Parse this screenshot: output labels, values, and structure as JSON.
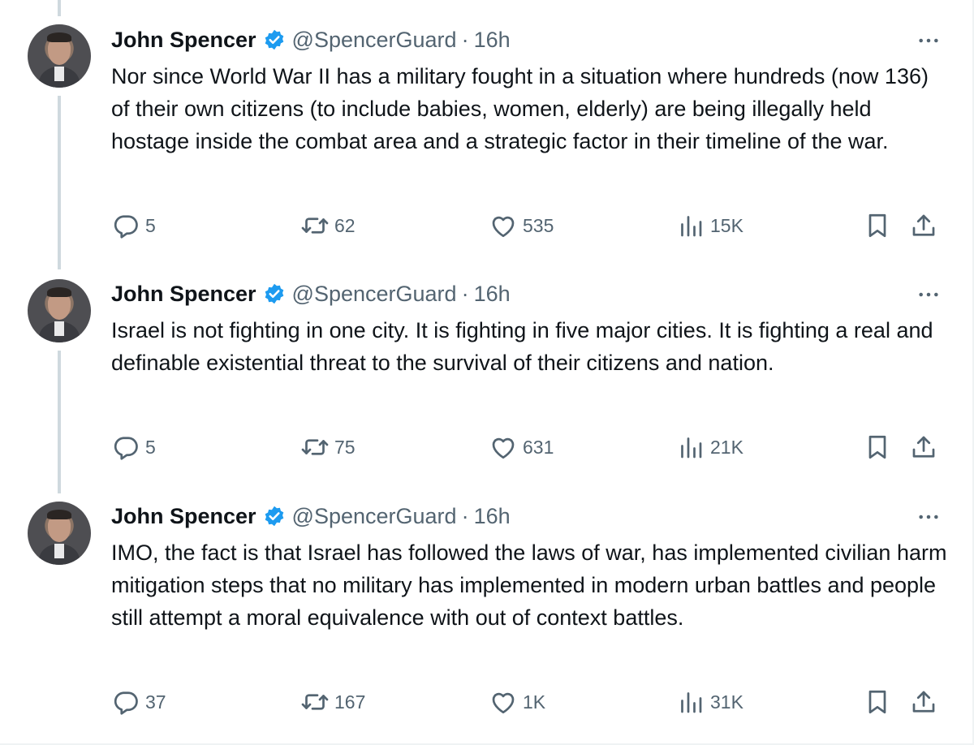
{
  "colors": {
    "verified": "#1d9bf0",
    "muted": "#536471",
    "text": "#0f1419",
    "thread_line": "#cfd9de"
  },
  "tweets": [
    {
      "name": "John Spencer",
      "handle": "@SpencerGuard",
      "separator": "·",
      "time": "16h",
      "text": "Nor since World War II has a military fought in a situation where hundreds (now 136) of their own citizens (to include babies, women, elderly) are being illegally held hostage inside the combat area and a strategic factor in their timeline of the war.",
      "replies": "5",
      "reposts": "62",
      "likes": "535",
      "views": "15K"
    },
    {
      "name": "John Spencer",
      "handle": "@SpencerGuard",
      "separator": "·",
      "time": "16h",
      "text": "Israel is not fighting in one city. It is fighting in five major cities. It is fighting a real and definable existential threat to the survival of their citizens and nation.",
      "replies": "5",
      "reposts": "75",
      "likes": "631",
      "views": "21K"
    },
    {
      "name": "John Spencer",
      "handle": "@SpencerGuard",
      "separator": "·",
      "time": "16h",
      "text": "IMO, the fact is that Israel has followed the laws of war, has implemented civilian harm mitigation steps that no military has implemented in modern urban battles and people still attempt a moral equivalence with out of context battles.",
      "replies": "37",
      "reposts": "167",
      "likes": "1K",
      "views": "31K"
    }
  ],
  "icons": [
    "reply-icon",
    "repost-icon",
    "like-icon",
    "views-icon",
    "bookmark-icon",
    "share-icon",
    "more-icon",
    "verified-badge-icon"
  ]
}
